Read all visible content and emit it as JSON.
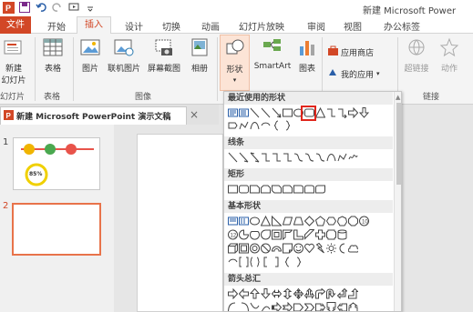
{
  "window": {
    "title": "新建 Microsoft Power"
  },
  "quick_access": {
    "icons": [
      "powerpoint-icon",
      "save-icon",
      "undo-icon",
      "redo-icon",
      "start-from-beginning-icon",
      "customize-icon"
    ]
  },
  "ribbon_tabs": [
    {
      "label": "文件"
    },
    {
      "label": "开始"
    },
    {
      "label": "插入"
    },
    {
      "label": "设计"
    },
    {
      "label": "切换"
    },
    {
      "label": "动画"
    },
    {
      "label": "幻灯片放映"
    },
    {
      "label": "审阅"
    },
    {
      "label": "视图"
    },
    {
      "label": "办公标签"
    }
  ],
  "ribbon": {
    "new_slide": {
      "line1": "新建",
      "line2": "幻灯片"
    },
    "table": {
      "label": "表格"
    },
    "picture": {
      "label": "图片"
    },
    "online_picture": {
      "label": "联机图片"
    },
    "screenshot": {
      "label": "屏幕截图"
    },
    "album": {
      "label": "相册"
    },
    "shapes": {
      "label": "形状"
    },
    "smartart": {
      "label": "SmartArt"
    },
    "chart": {
      "label": "图表"
    },
    "app_store": {
      "label": "应用商店"
    },
    "my_apps": {
      "label": "我的应用"
    },
    "hyperlink": {
      "label": "超链接"
    },
    "action": {
      "label": "动作"
    },
    "groups": {
      "slides": "幻灯片",
      "tables": "表格",
      "images": "图像",
      "links": "链接"
    }
  },
  "document_tab": {
    "title": "新建 Microsoft PowerPoint 演示文稿"
  },
  "slides_panel": {
    "slides": [
      {
        "number": "1",
        "badge": "85%"
      },
      {
        "number": "2"
      }
    ]
  },
  "shapes_dropdown": {
    "sections": [
      {
        "title": "最近使用的形状"
      },
      {
        "title": "线条"
      },
      {
        "title": "矩形"
      },
      {
        "title": "基本形状"
      },
      {
        "title": "箭头总汇"
      }
    ],
    "selected_shape": "oval"
  },
  "colors": {
    "accent": "#d24726",
    "shapes_highlight": "#fce4d6",
    "selection_box": "#e0261c",
    "active_slide_border": "#e8734a"
  }
}
